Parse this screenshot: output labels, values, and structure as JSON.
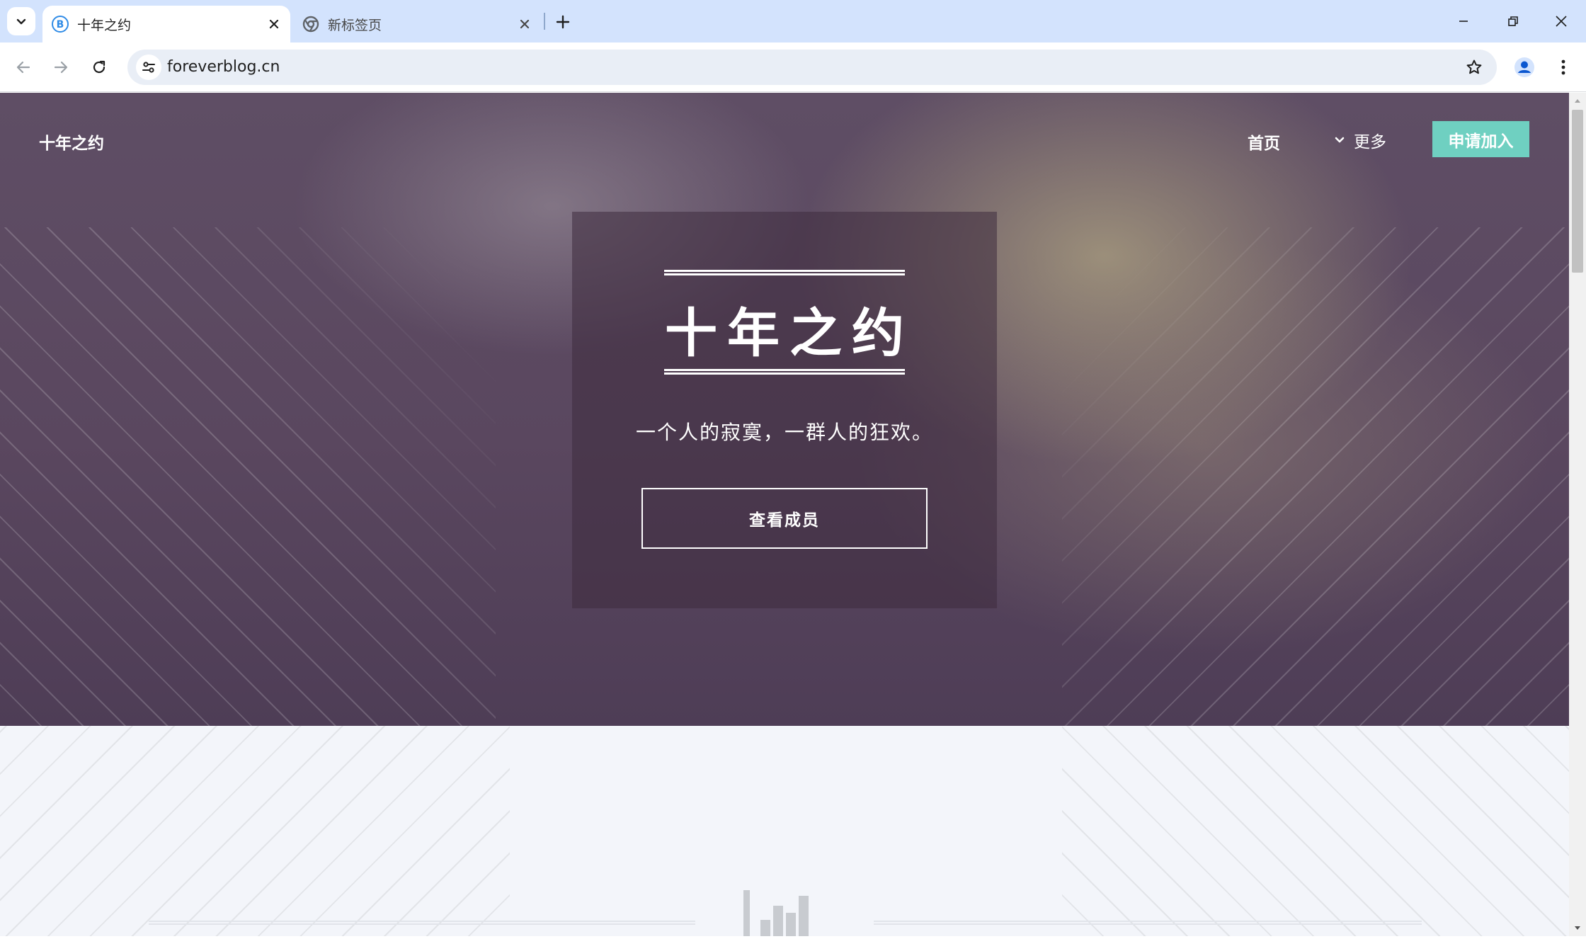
{
  "browser": {
    "tabs": [
      {
        "title": "十年之约",
        "active": true,
        "favicon": "blog-b-icon"
      },
      {
        "title": "新标签页",
        "active": false,
        "favicon": "chrome-icon"
      }
    ],
    "url": "foreverblog.cn"
  },
  "site": {
    "logo": "十年之约",
    "nav": {
      "home": "首页",
      "more": "更多",
      "join": "申请加入"
    },
    "hero": {
      "title": "十年之约",
      "subtitle": "一个人的寂寞，一群人的狂欢。",
      "button": "查看成员"
    }
  },
  "colors": {
    "tabstrip": "#d3e3fd",
    "accent": "#6fd0c1",
    "hero": "#5a475f",
    "page_bg": "#f3f5fa"
  }
}
